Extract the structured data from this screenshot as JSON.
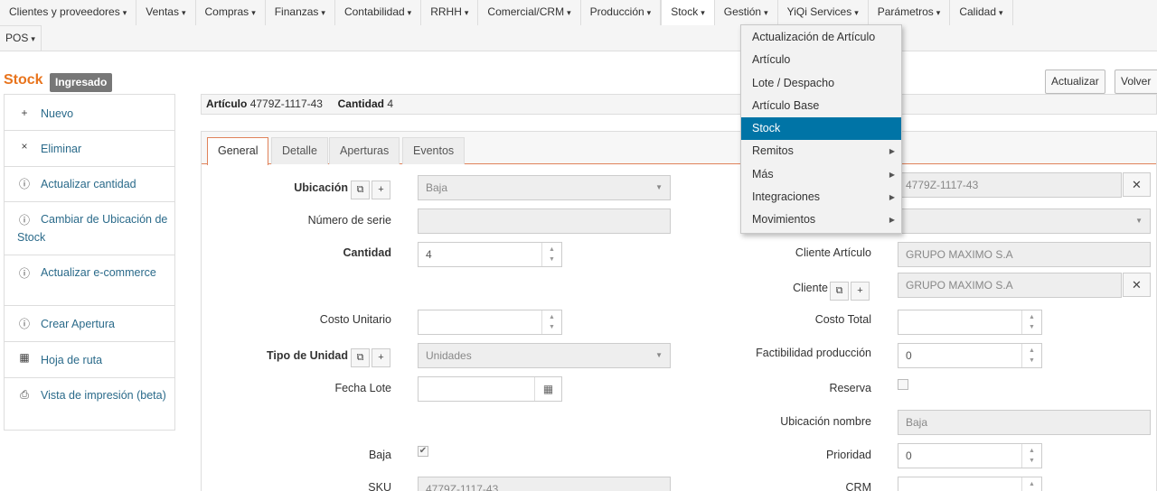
{
  "nav": {
    "row1": [
      {
        "label": "Clientes y proveedores",
        "caret": "▾"
      },
      {
        "label": "Ventas",
        "caret": "▾"
      },
      {
        "label": "Compras",
        "caret": "▾"
      },
      {
        "label": "Finanzas",
        "caret": "▾"
      },
      {
        "label": "Contabilidad",
        "caret": "▾"
      },
      {
        "label": "RRHH",
        "caret": "▾"
      },
      {
        "label": "Comercial/CRM",
        "caret": "▾"
      },
      {
        "label": "Producción",
        "caret": "▾"
      },
      {
        "label": "Stock",
        "caret": "▾"
      },
      {
        "label": "Gestión",
        "caret": "▾"
      },
      {
        "label": "YiQi Services",
        "caret": "▾"
      },
      {
        "label": "Parámetros",
        "caret": "▾"
      },
      {
        "label": "Calidad",
        "caret": "▾"
      }
    ],
    "row2": [
      {
        "label": "POS",
        "caret": "▾"
      }
    ]
  },
  "dropdown": {
    "items": [
      {
        "label": "Actualización de Artículo",
        "submenu": false,
        "active": false
      },
      {
        "label": "Artículo",
        "submenu": false,
        "active": false
      },
      {
        "label": "Lote / Despacho",
        "submenu": false,
        "active": false
      },
      {
        "label": "Artículo Base",
        "submenu": false,
        "active": false
      },
      {
        "label": "Stock",
        "submenu": false,
        "active": true
      },
      {
        "label": "Remitos",
        "submenu": true,
        "active": false
      },
      {
        "label": "Más",
        "submenu": true,
        "active": false
      },
      {
        "label": "Integraciones",
        "submenu": true,
        "active": false
      },
      {
        "label": "Movimientos",
        "submenu": true,
        "active": false
      }
    ],
    "submenu_arrow": "▶",
    "active_color": "#0074a6"
  },
  "header": {
    "title": "Stock",
    "badge": "Ingresado",
    "btn_update": "Actualizar",
    "btn_back": "Volver"
  },
  "sidebar": {
    "items": [
      {
        "icon": "+",
        "icon_name": "plus-icon",
        "label": "Nuevo"
      },
      {
        "icon": "×",
        "icon_name": "close-icon",
        "label": "Eliminar"
      },
      {
        "icon": "ⓘ",
        "icon_name": "alert-circle-icon",
        "label": "Actualizar cantidad"
      },
      {
        "icon": "ⓘ",
        "icon_name": "alert-circle-icon",
        "label": "Cambiar de Ubicación de Stock"
      },
      {
        "icon": "ⓘ",
        "icon_name": "alert-circle-icon",
        "label": "Actualizar e-commerce"
      },
      {
        "icon": "ⓘ",
        "icon_name": "alert-circle-icon",
        "label": "Crear Apertura"
      },
      {
        "icon": "▦",
        "icon_name": "calendar-icon",
        "label": "Hoja de ruta"
      },
      {
        "icon": "⎙",
        "icon_name": "print-icon",
        "label": "Vista de impresión (beta)"
      }
    ]
  },
  "infobar": {
    "articulo_label": "Artículo",
    "articulo_value": "4779Z-1117-43",
    "cantidad_label": "Cantidad",
    "cantidad_value": "4"
  },
  "tabs": [
    "General",
    "Detalle",
    "Aperturas",
    "Eventos"
  ],
  "form": {
    "ubicacion_label": "Ubicación",
    "ubicacion_value": "Baja",
    "serie_label": "Número de serie",
    "serie_value": "",
    "cantidad_label": "Cantidad",
    "cantidad_value": "4",
    "costo_unitario_label": "Costo Unitario",
    "costo_unitario_value": "",
    "tipo_unidad_label": "Tipo de Unidad",
    "tipo_unidad_value": "Unidades",
    "fecha_lote_label": "Fecha Lote",
    "fecha_lote_value": "",
    "baja_label": "Baja",
    "baja_checked": "✔",
    "sku_label": "SKU",
    "sku_value": "4779Z-1117-43",
    "articulo_value": "4779Z-1117-43",
    "cliente_articulo_label": "Cliente Artículo",
    "cliente_articulo_value": "GRUPO MAXIMO S.A",
    "cliente_label": "Cliente",
    "cliente_value": "GRUPO MAXIMO S.A",
    "costo_total_label": "Costo Total",
    "costo_total_value": "",
    "factibilidad_label": "Factibilidad producción",
    "factibilidad_value": "0",
    "reserva_label": "Reserva",
    "ubicacion_nombre_label": "Ubicación nombre",
    "ubicacion_nombre_value": "Baja",
    "prioridad_label": "Prioridad",
    "prioridad_value": "0",
    "crm_label": "CRM",
    "crm_value": ""
  },
  "colors": {
    "accent": "#e8741d",
    "link": "#2a6a8a",
    "badge": "#777777"
  }
}
